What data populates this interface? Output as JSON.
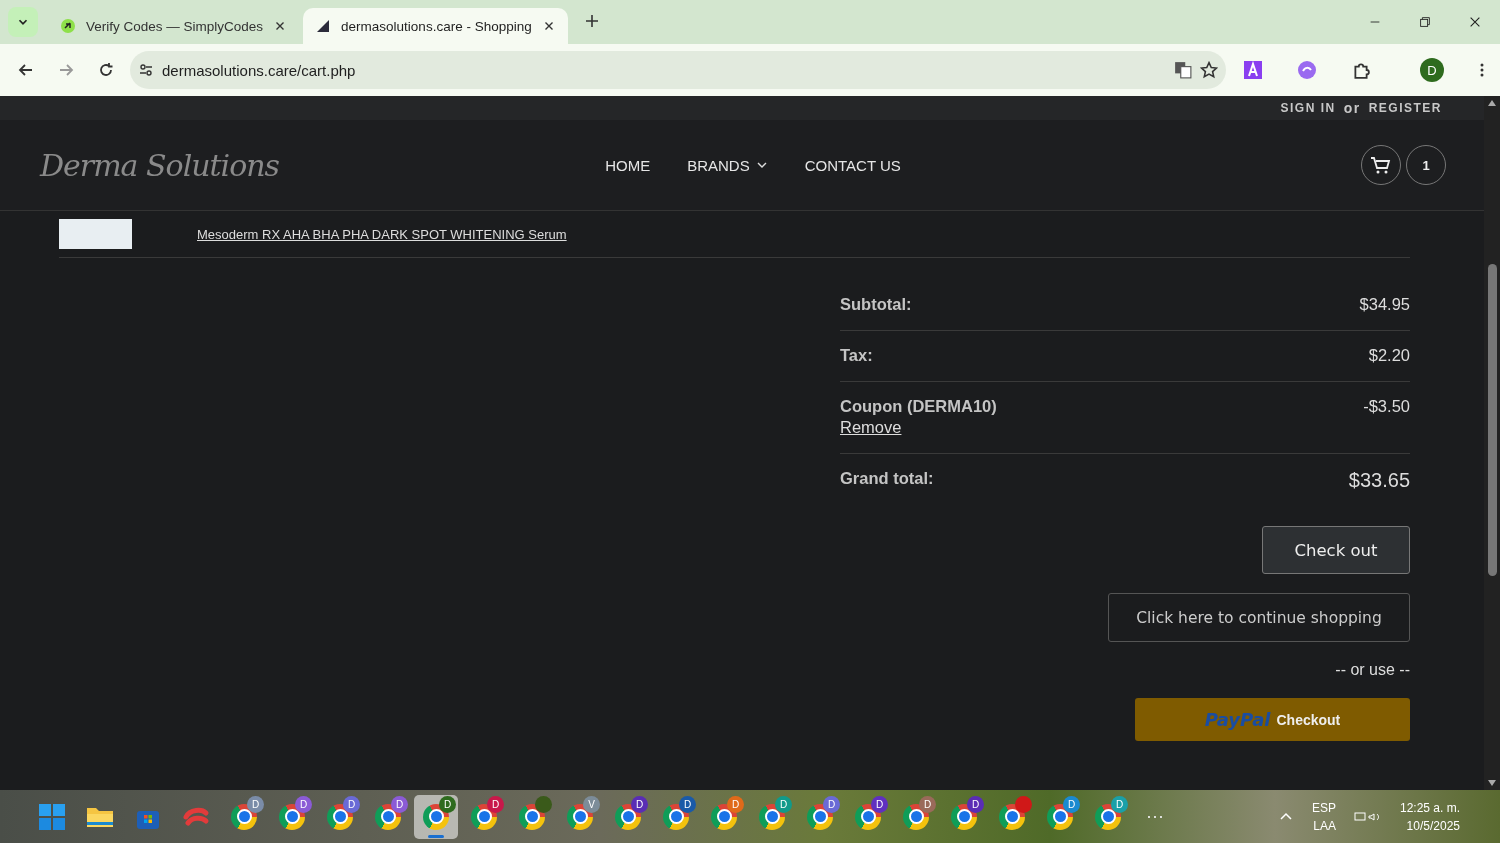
{
  "browser": {
    "tabs": [
      {
        "title": "Verify Codes — SimplyCodes",
        "selected": false
      },
      {
        "title": "dermasolutions.care - Shopping",
        "selected": true
      }
    ],
    "url": "dermasolutions.care/cart.php",
    "profile_initial": "D"
  },
  "site": {
    "sign_in": "SIGN IN",
    "or": "or",
    "register": "REGISTER",
    "logo": "Derma Solutions",
    "nav": [
      {
        "label": "HOME",
        "dropdown": false
      },
      {
        "label": "BRANDS",
        "dropdown": true
      },
      {
        "label": "CONTACT US",
        "dropdown": false
      }
    ],
    "cart_count": "1"
  },
  "cart_item": {
    "name": "Mesoderm RX AHA BHA PHA DARK SPOT WHITENING Serum"
  },
  "totals": [
    {
      "kind": "line",
      "label": "Subtotal:",
      "value": "$34.95"
    },
    {
      "kind": "line",
      "label": "Tax:",
      "value": "$2.20"
    },
    {
      "kind": "coupon",
      "label": "Coupon (DERMA10)",
      "value": "-$3.50",
      "action": "Remove"
    },
    {
      "kind": "grand",
      "label": "Grand total:",
      "value": "$33.65"
    }
  ],
  "actions": {
    "checkout": "Check out",
    "continue": "Click here to continue shopping",
    "or_use": "-- or use --",
    "paypal_brand": "PayPal",
    "paypal_label": "Checkout"
  },
  "taskbar": {
    "apps": [
      {
        "kind": "start",
        "selected": false
      },
      {
        "kind": "explorer",
        "selected": false
      },
      {
        "kind": "store",
        "selected": false
      },
      {
        "kind": "app",
        "selected": false
      },
      {
        "kind": "chrome",
        "badge": "D",
        "color": "#7a8ca8",
        "selected": false
      },
      {
        "kind": "chrome",
        "badge": "D",
        "color": "#8b5bd6",
        "selected": false
      },
      {
        "kind": "chrome",
        "badge": "D",
        "color": "#6a6ad6",
        "selected": false
      },
      {
        "kind": "chrome",
        "badge": "D",
        "color": "#8b5bd6",
        "selected": false
      },
      {
        "kind": "chrome",
        "badge": "D",
        "color": "#2e6b1e",
        "selected": true
      },
      {
        "kind": "chrome",
        "badge": "D",
        "color": "#c8184a",
        "selected": false
      },
      {
        "kind": "chrome-avatar",
        "color": "#3a5a1a",
        "selected": false
      },
      {
        "kind": "chrome",
        "badge": "V",
        "color": "#7c8c99",
        "selected": false
      },
      {
        "kind": "chrome",
        "badge": "D",
        "color": "#5a2db5",
        "selected": false
      },
      {
        "kind": "chrome",
        "badge": "D",
        "color": "#1a5aa8",
        "selected": false
      },
      {
        "kind": "chrome",
        "badge": "D",
        "color": "#e06a1a",
        "selected": false
      },
      {
        "kind": "chrome",
        "badge": "D",
        "color": "#119a8a",
        "selected": false
      },
      {
        "kind": "chrome",
        "badge": "D",
        "color": "#6a6ad6",
        "selected": false
      },
      {
        "kind": "chrome",
        "badge": "D",
        "color": "#6030c0",
        "selected": false
      },
      {
        "kind": "chrome",
        "badge": "D",
        "color": "#9a6a5a",
        "selected": false
      },
      {
        "kind": "chrome",
        "badge": "D",
        "color": "#5a2db5",
        "selected": false
      },
      {
        "kind": "chrome-avatar",
        "color": "#d01818",
        "selected": false
      },
      {
        "kind": "chrome",
        "badge": "D",
        "color": "#1a8ad0",
        "selected": false
      },
      {
        "kind": "chrome",
        "badge": "D",
        "color": "#1aa0a8",
        "selected": false
      }
    ],
    "more": "···",
    "lang": "ESP",
    "layout": "LAA",
    "time": "12:25 a. m.",
    "date": "10/5/2025"
  }
}
